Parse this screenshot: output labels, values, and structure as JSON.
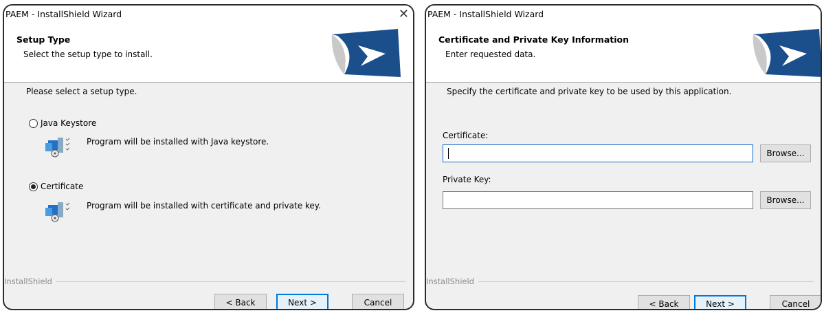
{
  "left_window": {
    "title": "PAEM - InstallShield Wizard",
    "close_glyph": "✕",
    "banner_title": "Setup Type",
    "banner_subtitle": "Select the setup type to install.",
    "prompt": "Please select a setup type.",
    "options": [
      {
        "label": "Java Keystore",
        "selected": false,
        "description": "Program will be installed with Java keystore.",
        "icon": "install-package-icon"
      },
      {
        "label": "Certificate",
        "selected": true,
        "description": "Program will be installed with certificate and private key.",
        "icon": "install-package-icon"
      }
    ],
    "brand": "InstallShield",
    "buttons": {
      "back": "< Back",
      "next": "Next >",
      "cancel": "Cancel"
    }
  },
  "right_window": {
    "title": "PAEM - InstallShield Wizard",
    "banner_title": "Certificate and Private Key Information",
    "banner_subtitle": "Enter requested data.",
    "prompt": "Specify the certificate and private key to be used by this application.",
    "certificate": {
      "label": "Certificate:",
      "value": "",
      "browse": "Browse..."
    },
    "private_key": {
      "label": "Private Key:",
      "value": "",
      "browse": "Browse..."
    },
    "brand": "InstallShield",
    "buttons": {
      "back": "< Back",
      "next": "Next >",
      "cancel": "Cancel"
    }
  },
  "colors": {
    "accent": "#0078d7",
    "dialog_bg": "#f0f0f0",
    "logo_blue": "#1a4f8c"
  }
}
